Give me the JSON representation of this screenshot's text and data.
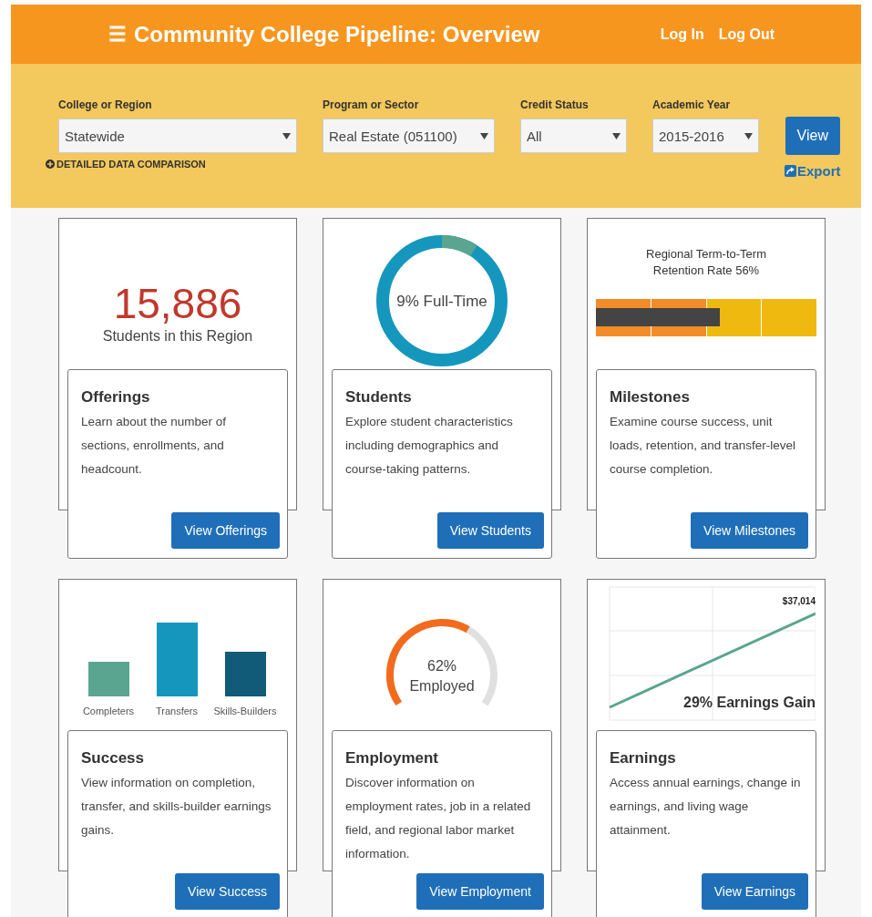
{
  "header": {
    "menu_glyph": "☰",
    "title": "Community College Pipeline: Overview",
    "links": [
      "Log In",
      "Log Out"
    ]
  },
  "filters": [
    {
      "label": "College or Region",
      "value": "Statewide"
    },
    {
      "label": "Program or Sector",
      "value": "Real Estate (051100)"
    },
    {
      "label": "Credit Status",
      "value": "All"
    },
    {
      "label": "Academic Year",
      "value": "2015-2016"
    }
  ],
  "comparison_link": "DETAILED DATA COMPARISON",
  "view_button": "View",
  "export_link": "Export",
  "tiles": [
    {
      "kind": "count",
      "value": "15,886",
      "caption": "Students in this Region",
      "title": "Offerings",
      "description": "Learn about the number of sections, enrollments, and headcount.",
      "button": "View Offerings"
    },
    {
      "kind": "donut",
      "level": 0.09,
      "label": "9% Full-Time",
      "title": "Students",
      "description": "Explore student characteristics including demographics and course-taking patterns.",
      "button": "View Students"
    },
    {
      "kind": "bullet",
      "level": 0.56,
      "caption": "Regional Term-to-Term Retention Rate 56%",
      "title": "Milestones",
      "description": "Examine course success, unit loads, retention, and transfer-level course completion.",
      "button": "View Milestones"
    },
    {
      "kind": "bars",
      "labels": [
        "Completers",
        "Transfers",
        "Skills-Builders"
      ],
      "title": "Success",
      "description": "View information on completion, transfer, and skills-builder earnings gains.",
      "button": "View Success"
    },
    {
      "kind": "gauge",
      "level": 0.62,
      "value": "62%",
      "caption": "Employed",
      "title": "Employment",
      "description": "Discover information on employment rates, job in a related field, and regional labor market information.",
      "button": "View Employment"
    },
    {
      "kind": "line",
      "end_label": "$37,014",
      "caption": "29% Earnings Gain",
      "title": "Earnings",
      "description": "Access annual earnings, change in earnings, and living wage attainment.",
      "button": "View Earnings"
    }
  ]
}
